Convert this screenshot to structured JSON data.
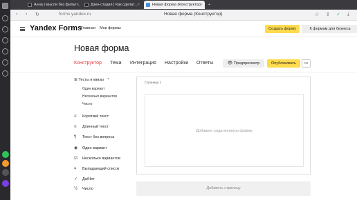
{
  "browser": {
    "tabs": [
      {
        "label": "Анна | мысли без фильт…"
      },
      {
        "label": "Дзен-студия | Как сделат…"
      },
      {
        "label": "Новая форма (Конструктор)"
      }
    ],
    "url": "forms.yandex.ru",
    "page_title": "Новая форма (Конструктор)"
  },
  "header": {
    "brand": "Yandex Forms",
    "nav": [
      "Главная",
      "Мои формы"
    ],
    "create_button": "Создать форму",
    "business_button": "К формам для бизнеса"
  },
  "form": {
    "title": "Новая форма",
    "tabs": [
      "Конструктор",
      "Тема",
      "Интеграция",
      "Настройки",
      "Ответы"
    ],
    "preview_button": "Предпросмотр",
    "publish_button": "Опубликовать",
    "more_button": "•••"
  },
  "sidebar": {
    "group": "Тесты и квизы",
    "group_items": [
      "Один вариант",
      "Несколько вариантов",
      "Число"
    ],
    "items": [
      {
        "label": "Короткий текст",
        "icon": "short-text-icon",
        "glyph": "≡"
      },
      {
        "label": "Длинный текст",
        "icon": "long-text-icon",
        "glyph": "≡"
      },
      {
        "label": "Текст без вопроса",
        "icon": "paragraph-icon",
        "glyph": "¶"
      },
      {
        "label": "Один вариант",
        "icon": "radio-icon",
        "glyph": "◉"
      },
      {
        "label": "Несколько вариантов",
        "icon": "checkbox-icon",
        "glyph": "☑"
      },
      {
        "label": "Выпадающий список",
        "icon": "dropdown-icon",
        "glyph": "▾"
      },
      {
        "label": "Да/Нет",
        "icon": "yes-no-icon",
        "glyph": "✓"
      },
      {
        "label": "Число",
        "icon": "number-icon",
        "glyph": "½"
      }
    ]
  },
  "canvas": {
    "page_label": "Страница 1",
    "drop_hint": "Добавьте сюда вопросы формы",
    "add_page": "Добавить страницу"
  }
}
